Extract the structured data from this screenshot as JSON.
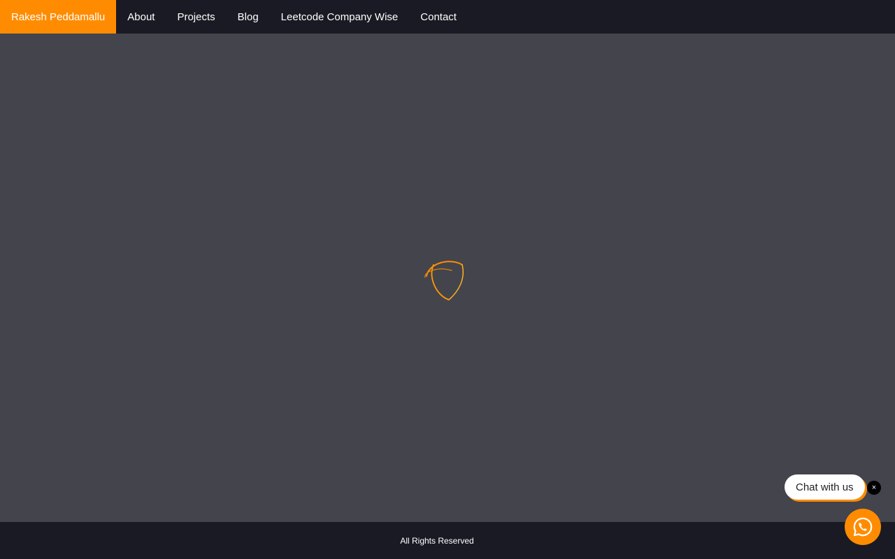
{
  "navbar": {
    "brand": "Rakesh Peddamallu",
    "links": [
      "About",
      "Projects",
      "Blog",
      "Leetcode Company Wise",
      "Contact"
    ]
  },
  "footer": {
    "text": "All Rights Reserved"
  },
  "chat": {
    "label": "Chat with us",
    "close": "×"
  },
  "colors": {
    "accent": "#ff8c00",
    "navbar_bg": "#1a1a24",
    "page_bg": "#44444d"
  },
  "icons": {
    "loader": "loading-spinner-icon",
    "whatsapp": "whatsapp-icon"
  }
}
